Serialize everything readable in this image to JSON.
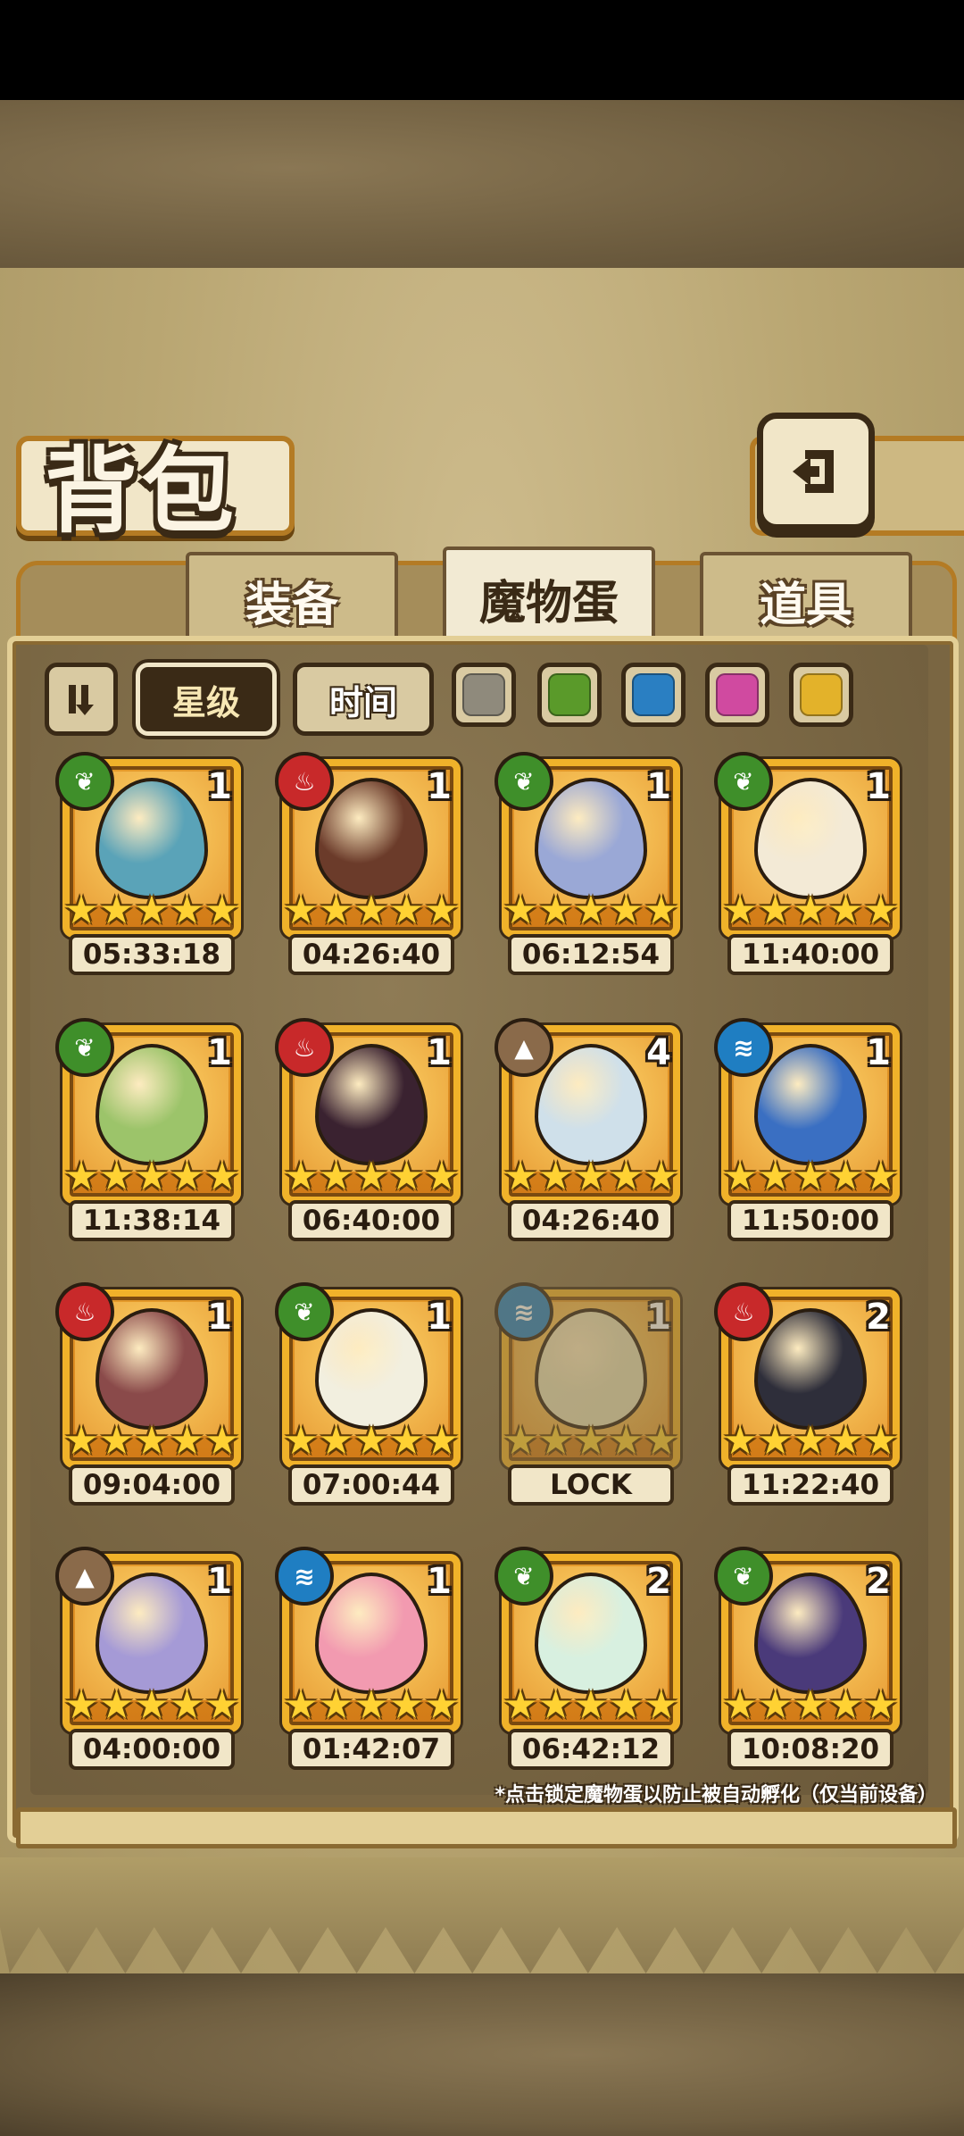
{
  "header": {
    "title": "背包",
    "back_icon": "back-arrow-icon"
  },
  "tabs": [
    {
      "label": "装备",
      "active": false
    },
    {
      "label": "魔物蛋",
      "active": true
    },
    {
      "label": "道具",
      "active": false
    }
  ],
  "filters": {
    "sort_icon": "sort-toggle-icon",
    "star_label": "星级",
    "time_label": "时间",
    "colors": [
      "#8f8a7c",
      "#5a9a2a",
      "#2a7fc2",
      "#d04aa0",
      "#e3b22a"
    ]
  },
  "eggs": [
    {
      "element": "grass",
      "count": "1",
      "stars": "★★★★★",
      "timer": "05:33:18",
      "color": "#5aa3b8"
    },
    {
      "element": "fire",
      "count": "1",
      "stars": "★★★★★",
      "timer": "04:26:40",
      "color": "#6b3b2a"
    },
    {
      "element": "grass",
      "count": "1",
      "stars": "★★★★★",
      "timer": "06:12:54",
      "color": "#9aa8d6"
    },
    {
      "element": "grass",
      "count": "1",
      "stars": "★★★★★",
      "timer": "11:40:00",
      "color": "#f3ead6"
    },
    {
      "element": "grass",
      "count": "1",
      "stars": "★★★★★",
      "timer": "11:38:14",
      "color": "#9cc46a"
    },
    {
      "element": "fire",
      "count": "1",
      "stars": "★★★★★",
      "timer": "06:40:00",
      "color": "#3a2230"
    },
    {
      "element": "earth",
      "count": "4",
      "stars": "★★★★★",
      "timer": "04:26:40",
      "color": "#cfe0ea"
    },
    {
      "element": "water",
      "count": "1",
      "stars": "★★★★★",
      "timer": "11:50:00",
      "color": "#3a6fc2"
    },
    {
      "element": "fire",
      "count": "1",
      "stars": "★★★★★",
      "timer": "09:04:00",
      "color": "#8a4a4a"
    },
    {
      "element": "grass",
      "count": "1",
      "stars": "★★★★★",
      "timer": "07:00:44",
      "color": "#f2efdf"
    },
    {
      "element": "water",
      "count": "1",
      "stars": "★★★★★",
      "timer": "LOCK",
      "color": "#e8e2b8",
      "locked": true
    },
    {
      "element": "fire",
      "count": "2",
      "stars": "★★★★★",
      "timer": "11:22:40",
      "color": "#2e2e3a"
    },
    {
      "element": "earth",
      "count": "1",
      "stars": "★★★★★",
      "timer": "04:00:00",
      "color": "#a59ad6"
    },
    {
      "element": "water",
      "count": "1",
      "stars": "★★★★★",
      "timer": "01:42:07",
      "color": "#f29ab0"
    },
    {
      "element": "grass",
      "count": "2",
      "stars": "★★★★★",
      "timer": "06:42:12",
      "color": "#d8f0e0"
    },
    {
      "element": "grass",
      "count": "2",
      "stars": "★★★★★",
      "timer": "10:08:20",
      "color": "#4a3a7a"
    }
  ],
  "element_colors": {
    "grass": "#3f8f2a",
    "fire": "#c8292a",
    "water": "#1f7ec2",
    "earth": "#8a6a4a"
  },
  "element_glyphs": {
    "grass": "❦",
    "fire": "♨",
    "water": "≋",
    "earth": "▲"
  },
  "footnote": "*点击锁定魔物蛋以防止被自动孵化（仅当前设备）"
}
